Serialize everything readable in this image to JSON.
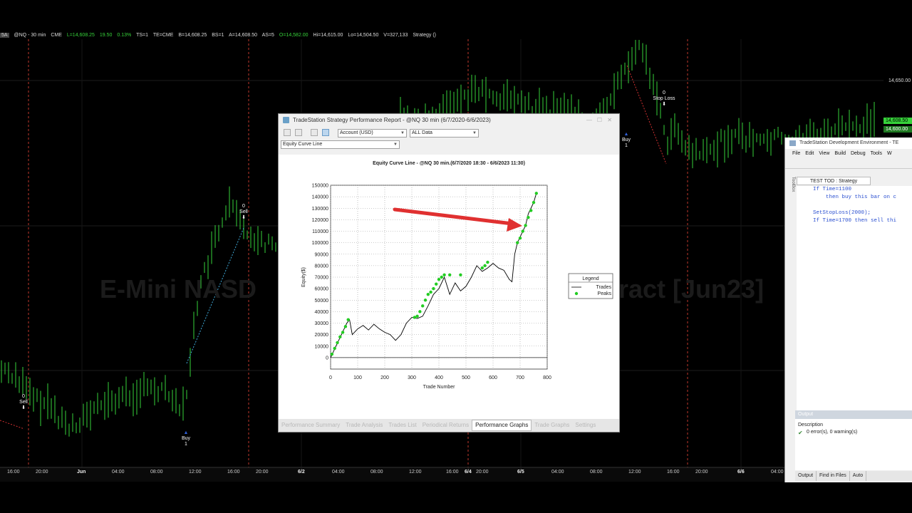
{
  "status_bar": {
    "symbol_badge": "5A",
    "symbol": "@NQ - 30 min",
    "exchange": "CME",
    "last": "L=14,608.25",
    "change": "19.50",
    "change_pct": "0.13%",
    "ts": "TS=1",
    "te": "TE=CME",
    "bid": "B=14,608.25",
    "bid_size": "BS=1",
    "ask": "A=14,608.50",
    "ask_size": "AS=5",
    "open": "O=14,582.00",
    "high": "Hi=14,615.00",
    "low": "Lo=14,504.50",
    "volume": "V=327,133",
    "strategy": "Strategy ()"
  },
  "watermark": {
    "left": "E-Mini NASD",
    "right": "ract [Jun23]"
  },
  "price_axis": {
    "label_top": "14,650.00",
    "label_last": "14,608.50",
    "label_low": "14,600.00"
  },
  "colors": {
    "bar_green": "#36d23a",
    "session_red": "#c0392b",
    "arrow_red": "#e03030",
    "peaks_green": "#22cc22"
  },
  "annotations": {
    "sell1_count": "0",
    "sell1": "Sell",
    "sell2_count": "0",
    "sell2": "Sell",
    "buy1": "Buy",
    "buy1_count": "1",
    "buy2": "Buy",
    "buy2_count": "1",
    "stop_count": "0",
    "stop": "Stop Loss"
  },
  "time_axis": {
    "labels": [
      "16:00",
      "20:00",
      "Jun",
      "04:00",
      "08:00",
      "12:00",
      "16:00",
      "20:00",
      "6/2",
      "04:00",
      "08:00",
      "12:00",
      "16:00",
      "6/4",
      "20:00",
      "6/5",
      "04:00",
      "08:00",
      "12:00",
      "16:00",
      "20:00",
      "6/6",
      "04:00"
    ]
  },
  "report": {
    "title": "TradeStation Strategy Performance Report - @NQ 30 min (6/7/2020-6/6/2023)",
    "account_select": "Account (USD)",
    "range_select": "ALL Data",
    "graph_select": "Equity Curve Line",
    "graph_title": "Equity Curve Line - @NQ 30 min.(6/7/2020 18:30 - 6/6/2023 11:30)",
    "legend_title": "Legend",
    "legend_trades": "Trades",
    "legend_peaks": "Peaks",
    "tabs": [
      "Performance Summary",
      "Trade Analysis",
      "Trades List",
      "Periodical Returns",
      "Performance Graphs",
      "Trade Graphs",
      "Settings"
    ]
  },
  "chart_data": {
    "type": "line",
    "title": "Equity Curve Line - @NQ 30 min.(6/7/2020 18:30 - 6/6/2023 11:30)",
    "xlabel": "Trade Number",
    "ylabel": "Equity($)",
    "xlim": [
      0,
      800
    ],
    "ylim": [
      -10000,
      150000
    ],
    "x_ticks": [
      0,
      100,
      200,
      300,
      400,
      500,
      600,
      700,
      800
    ],
    "y_ticks": [
      0,
      10000,
      20000,
      30000,
      40000,
      50000,
      60000,
      70000,
      80000,
      90000,
      100000,
      110000,
      120000,
      130000,
      140000,
      150000
    ],
    "grid": true,
    "legend": "right",
    "series": [
      {
        "name": "Trades",
        "x": [
          0,
          10,
          20,
          30,
          40,
          50,
          60,
          70,
          80,
          100,
          120,
          140,
          160,
          180,
          200,
          220,
          240,
          260,
          280,
          300,
          320,
          340,
          360,
          380,
          400,
          420,
          440,
          460,
          480,
          500,
          520,
          540,
          560,
          580,
          600,
          620,
          640,
          660,
          670,
          680,
          690,
          700,
          710,
          720,
          730,
          740,
          750,
          760
        ],
        "y": [
          0,
          5000,
          10000,
          15000,
          20000,
          25000,
          30000,
          33000,
          20000,
          25000,
          28000,
          24000,
          29000,
          25000,
          22000,
          20000,
          15000,
          20000,
          30000,
          35000,
          34000,
          36000,
          45000,
          55000,
          60000,
          70000,
          55000,
          65000,
          58000,
          62000,
          70000,
          80000,
          75000,
          78000,
          82000,
          78000,
          76000,
          68000,
          66000,
          90000,
          100000,
          105000,
          110000,
          115000,
          125000,
          130000,
          135000,
          143000
        ]
      },
      {
        "name": "Peaks",
        "x": [
          5,
          15,
          25,
          35,
          45,
          55,
          65,
          310,
          320,
          330,
          340,
          350,
          360,
          370,
          380,
          390,
          400,
          410,
          420,
          440,
          480,
          560,
          570,
          580,
          690,
          700,
          710,
          720,
          730,
          740,
          750,
          760
        ],
        "y": [
          3000,
          8000,
          13000,
          18000,
          22000,
          27000,
          33000,
          35000,
          36000,
          40000,
          45000,
          50000,
          55000,
          57000,
          60000,
          64000,
          68000,
          70000,
          72000,
          72000,
          72000,
          78000,
          80000,
          83000,
          100000,
          104000,
          110000,
          115000,
          122000,
          128000,
          135000,
          143000
        ]
      }
    ]
  },
  "dev_env": {
    "title": "TradeStation Development Environment - TE",
    "menu": [
      "File",
      "Edit",
      "View",
      "Build",
      "Debug",
      "Tools",
      "W"
    ],
    "tab": "TEST TOD : Strategy",
    "toolbox": "ToolBox",
    "code_lines": [
      "If Time=1100",
      "    then buy this bar on c",
      "",
      "SetStopLoss(2000);",
      "If Time=1700 then sell thi"
    ],
    "output_title": "Output",
    "description_header": "Description",
    "message": "0 error(s), 0 warning(s)",
    "bottom_tabs": [
      "Output",
      "Find in Files",
      "Auto"
    ]
  }
}
